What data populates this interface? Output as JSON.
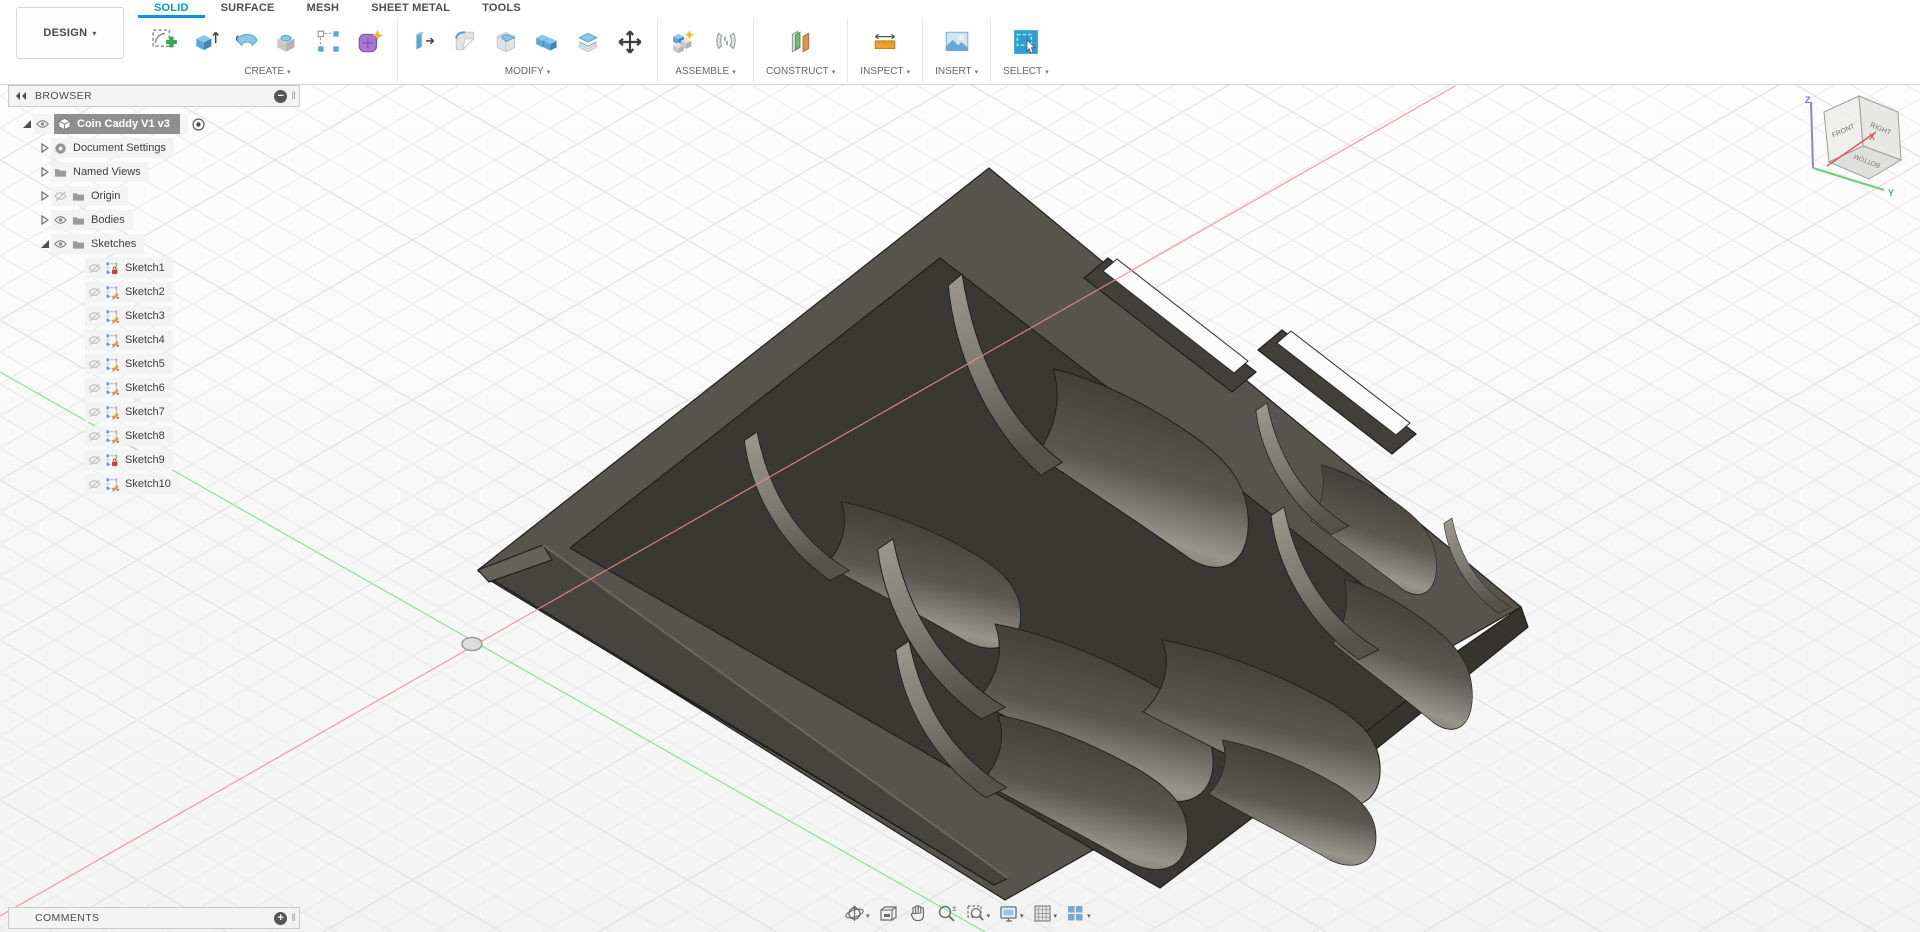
{
  "ui": {
    "caret": "▾",
    "accent": "#0696d7",
    "grip": "‖",
    "minus": "−",
    "plus": "+"
  },
  "app": {
    "design_label": "DESIGN"
  },
  "tabs": [
    {
      "label": "SOLID",
      "active": true
    },
    {
      "label": "SURFACE",
      "active": false
    },
    {
      "label": "MESH",
      "active": false
    },
    {
      "label": "SHEET METAL",
      "active": false
    },
    {
      "label": "TOOLS",
      "active": false
    }
  ],
  "ribbon_groups": [
    {
      "label": "CREATE",
      "icons": [
        "create-sketch",
        "extrude",
        "revolve",
        "hole",
        "rectangular-pattern",
        "form"
      ]
    },
    {
      "label": "MODIFY",
      "icons": [
        "press-pull",
        "fillet",
        "shell",
        "combine",
        "offset-face",
        "move"
      ]
    },
    {
      "label": "ASSEMBLE",
      "icons": [
        "new-component",
        "joint"
      ]
    },
    {
      "label": "CONSTRUCT",
      "icons": [
        "construct-plane"
      ]
    },
    {
      "label": "INSPECT",
      "icons": [
        "measure"
      ]
    },
    {
      "label": "INSERT",
      "icons": [
        "insert-canvas"
      ]
    },
    {
      "label": "SELECT",
      "icons": [
        "select-cursor"
      ]
    }
  ],
  "browser": {
    "title": "BROWSER",
    "tree": [
      {
        "label": "Coin Caddy V1 v3",
        "level": 0,
        "expand": "expanded",
        "eye": "visible",
        "icon": "component",
        "badge": null,
        "selected": true,
        "radio": true
      },
      {
        "label": "Document Settings",
        "level": 1,
        "expand": "collapsed",
        "eye": null,
        "icon": "gear",
        "badge": null,
        "selected": false,
        "radio": false
      },
      {
        "label": "Named Views",
        "level": 1,
        "expand": "collapsed",
        "eye": null,
        "icon": "folder",
        "badge": null,
        "selected": false,
        "radio": false
      },
      {
        "label": "Origin",
        "level": 1,
        "expand": "collapsed",
        "eye": "hidden",
        "icon": "folder",
        "badge": null,
        "selected": false,
        "radio": false
      },
      {
        "label": "Bodies",
        "level": 1,
        "expand": "collapsed",
        "eye": "visible",
        "icon": "folder",
        "badge": null,
        "selected": false,
        "radio": false
      },
      {
        "label": "Sketches",
        "level": 1,
        "expand": "expanded",
        "eye": "visible",
        "icon": "folder",
        "badge": null,
        "selected": false,
        "radio": false
      },
      {
        "label": "Sketch1",
        "level": 2,
        "expand": null,
        "eye": "hidden",
        "icon": "sketch",
        "badge": "lock",
        "selected": false,
        "radio": false
      },
      {
        "label": "Sketch2",
        "level": 2,
        "expand": null,
        "eye": "hidden",
        "icon": "sketch",
        "badge": "pencil",
        "selected": false,
        "radio": false
      },
      {
        "label": "Sketch3",
        "level": 2,
        "expand": null,
        "eye": "hidden",
        "icon": "sketch",
        "badge": "pencil",
        "selected": false,
        "radio": false
      },
      {
        "label": "Sketch4",
        "level": 2,
        "expand": null,
        "eye": "hidden",
        "icon": "sketch",
        "badge": "pencil",
        "selected": false,
        "radio": false
      },
      {
        "label": "Sketch5",
        "level": 2,
        "expand": null,
        "eye": "hidden",
        "icon": "sketch",
        "badge": "pencil",
        "selected": false,
        "radio": false
      },
      {
        "label": "Sketch6",
        "level": 2,
        "expand": null,
        "eye": "hidden",
        "icon": "sketch",
        "badge": "pencil",
        "selected": false,
        "radio": false
      },
      {
        "label": "Sketch7",
        "level": 2,
        "expand": null,
        "eye": "hidden",
        "icon": "sketch",
        "badge": "pencil",
        "selected": false,
        "radio": false
      },
      {
        "label": "Sketch8",
        "level": 2,
        "expand": null,
        "eye": "hidden",
        "icon": "sketch",
        "badge": "pencil",
        "selected": false,
        "radio": false
      },
      {
        "label": "Sketch9",
        "level": 2,
        "expand": null,
        "eye": "hidden",
        "icon": "sketch",
        "badge": "lock",
        "selected": false,
        "radio": false
      },
      {
        "label": "Sketch10",
        "level": 2,
        "expand": null,
        "eye": "hidden",
        "icon": "sketch",
        "badge": "pencil",
        "selected": false,
        "radio": false
      }
    ]
  },
  "comments": {
    "title": "COMMENTS"
  },
  "nav": [
    {
      "name": "orbit",
      "dropdown": true
    },
    {
      "name": "look-at",
      "dropdown": false
    },
    {
      "name": "pan",
      "dropdown": false
    },
    {
      "name": "zoom",
      "dropdown": false
    },
    {
      "name": "fit",
      "dropdown": true
    },
    {
      "name": "display-settings",
      "dropdown": true
    },
    {
      "name": "grid-display",
      "dropdown": true
    },
    {
      "name": "viewports",
      "dropdown": true
    }
  ],
  "viewcube": {
    "faces": {
      "front": "FRONT",
      "right": "RIGHT",
      "bottom": "BOTTOM"
    },
    "axes": {
      "x": {
        "label": "X",
        "color": "#d85c5c"
      },
      "y": {
        "label": "Y",
        "color": "#49b24c"
      },
      "z": {
        "label": "Z",
        "color": "#7070dd"
      }
    }
  },
  "canvas_colors": {
    "axis_x": "#ef8d88",
    "axis_y": "#8fe091",
    "model_top": "#56544c",
    "model_dark": "#46443e",
    "model_outline": "#1f1f1f"
  }
}
